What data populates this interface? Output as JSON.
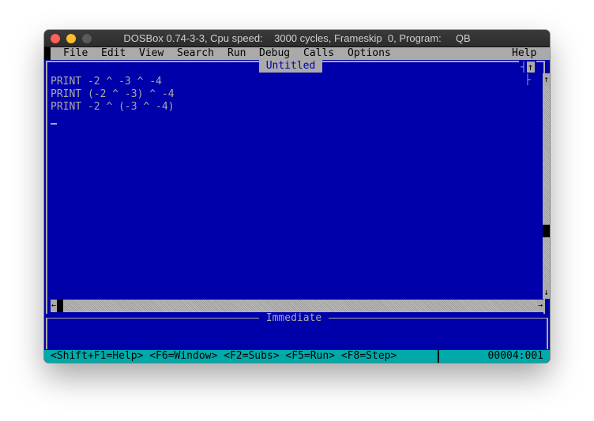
{
  "window": {
    "title": "DOSBox 0.74-3-3, Cpu speed:    3000 cycles, Frameskip  0, Program:     QB"
  },
  "menu": {
    "items": [
      {
        "label": "File"
      },
      {
        "label": "Edit"
      },
      {
        "label": "View"
      },
      {
        "label": "Search"
      },
      {
        "label": "Run"
      },
      {
        "label": "Debug"
      },
      {
        "label": "Calls"
      },
      {
        "label": "Options"
      }
    ],
    "help": "Help"
  },
  "editor": {
    "title": "Untitled",
    "lines": [
      "PRINT -2 ^ -3 ^ -4",
      "PRINT (-2 ^ -3) ^ -4",
      "PRINT -2 ^ (-3 ^ -4)"
    ],
    "window_control_icon": "maximize-arrow"
  },
  "immediate": {
    "title": "Immediate"
  },
  "status": {
    "text": "<Shift+F1=Help> <F6=Window> <F2=Subs> <F5=Run> <F8=Step>",
    "position": "00004:001"
  },
  "colors": {
    "background": "#0000aa",
    "foreground": "#aaaaaa",
    "statusbar": "#00aaaa",
    "close": "#fe5f57",
    "minimize": "#febc2e"
  }
}
